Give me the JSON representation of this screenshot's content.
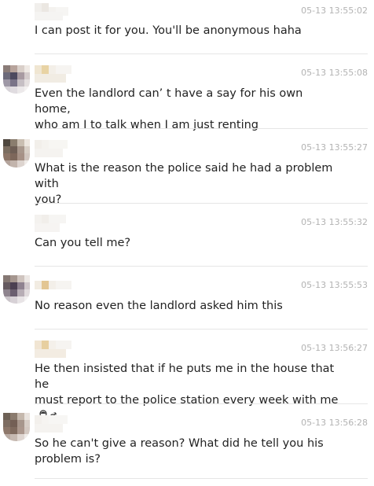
{
  "messages": [
    {
      "time": "05-13 13:55:02",
      "text": "I can post it for you. You'll be anonymous haha"
    },
    {
      "time": "05-13 13:55:08",
      "text": "Even the landlord can’  t have a say for his own home,\nwho am I to talk when I am just renting"
    },
    {
      "time": "05-13 13:55:27",
      "text": "What is the reason the police said he had a problem with\nyou?"
    },
    {
      "time": "05-13 13:55:32",
      "text": "Can you tell me?"
    },
    {
      "time": "05-13 13:55:53",
      "text": "No reason even the landlord asked him this"
    },
    {
      "time": "05-13 13:56:27",
      "text": "He then insisted that if he puts me in the house that he\nmust report to the police station every week with me"
    },
    {
      "time": "05-13 13:56:28",
      "text": "So he can't give a reason? What did he tell you his\nproblem is?"
    }
  ],
  "icons": {
    "avatar": "blurred-avatar-icon",
    "emoji": "person-gesturing-male-emoji-icon"
  }
}
